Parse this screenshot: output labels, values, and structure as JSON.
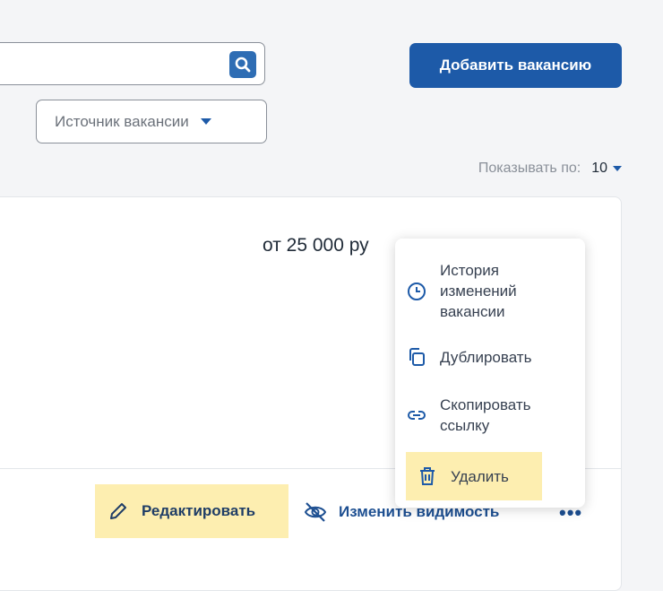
{
  "header": {
    "search": {
      "value": "",
      "placeholder": ""
    },
    "add_vacancy_label": "Добавить вакансию"
  },
  "filters": {
    "source_label": "Источник вакансии"
  },
  "pagination": {
    "per_page_label": "Показывать по:",
    "per_page_value": "10"
  },
  "vacancy": {
    "salary": "от 25 000 ру"
  },
  "actions": {
    "edit_label": "Редактировать",
    "visibility_label": "Изменить видимость",
    "more_label": "•••"
  },
  "menu": {
    "items": [
      {
        "label": "История изменений вакансии",
        "icon": "clock-icon"
      },
      {
        "label": "Дублировать",
        "icon": "copy-icon"
      },
      {
        "label": "Скопировать ссылку",
        "icon": "link-icon"
      },
      {
        "label": "Удалить",
        "icon": "trash-icon"
      }
    ]
  },
  "colors": {
    "primary": "#1d5aa8",
    "highlight": "#fdeeb0",
    "link": "#1d4f91"
  }
}
